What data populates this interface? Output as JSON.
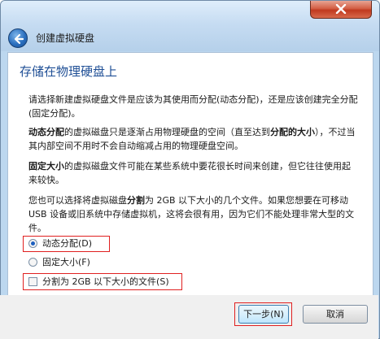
{
  "window": {
    "title": "创建虚拟硬盘",
    "close_symbol": "×"
  },
  "page": {
    "heading": "存储在物理硬盘上",
    "intro": "请选择新建虚拟硬盘文件是应该为其使用而分配(动态分配)，还是应该创建完全分配(固定分配)。",
    "dynamic_para": {
      "bold_start": "动态分配",
      "mid": "的虚拟磁盘只是逐渐占用物理硬盘的空间（直至达到",
      "bold_mid": "分配的大小",
      "end": "），不过当其内部空间不用时不会自动缩减占用的物理硬盘空间。"
    },
    "fixed_para": {
      "bold_start": "固定大小",
      "end": "的虚拟磁盘文件可能在某些系统中要花很长时间来创建，但它往往使用起来较快。"
    },
    "split_para": {
      "start": "您也可以选择将虚拟磁盘",
      "bold": "分割",
      "end": "为 2GB 以下大小的几个文件。如果您想要在可移动 USB 设备或旧系统中存储虚拟机，这将会很有用，因为它们不能处理非常大型的文件。"
    },
    "options": {
      "dynamic": {
        "label": "动态分配(D)",
        "checked": true
      },
      "fixed": {
        "label": "固定大小(F)",
        "checked": false
      },
      "split": {
        "label": "分割为 2GB 以下大小的文件(S)",
        "checked": false
      }
    }
  },
  "buttons": {
    "next": "下一步(N)",
    "cancel": "取消"
  },
  "colors": {
    "heading": "#1e4e95",
    "highlight": "#e02020",
    "titlebar": "#c6dcf2"
  }
}
